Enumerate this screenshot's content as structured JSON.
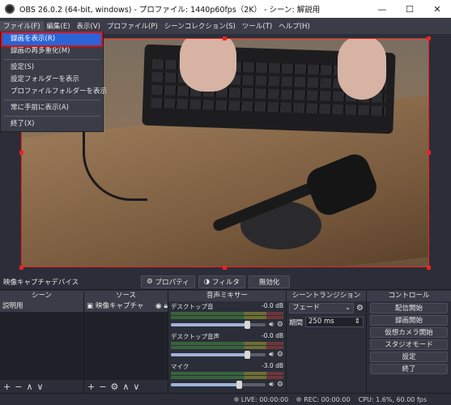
{
  "window": {
    "title": "OBS 26.0.2 (64-bit, windows) - プロファイル: 1440p60fps（2K） - シーン: 解説用",
    "minimize_glyph": "—",
    "maximize_glyph": "☐",
    "close_glyph": "✕"
  },
  "menubar": {
    "items": [
      "ファイル(F)",
      "編集(E)",
      "表示(V)",
      "プロファイル(P)",
      "シーンコレクション(S)",
      "ツール(T)",
      "ヘルプ(H)"
    ]
  },
  "file_menu": {
    "items": [
      "録画を表示(R)",
      "録画の再多重化(M)",
      "設定(S)",
      "設定フォルダーを表示",
      "プロファイルフォルダーを表示",
      "常に手前に表示(A)",
      "終了(X)"
    ]
  },
  "source_toolbar": {
    "source_name": "映像キャプチャデバイス",
    "properties_label": "プロパティ",
    "filters_label": "フィルタ",
    "deactivate_label": "無効化"
  },
  "scenes": {
    "header": "シーン",
    "items": [
      "説明用"
    ]
  },
  "sources": {
    "header": "ソース",
    "items": [
      "映像キャプチャ"
    ]
  },
  "mixer": {
    "header": "音声ミキサー",
    "channels": [
      {
        "name": "デスクトップ音",
        "db": "-0.0 dB",
        "level": 0.8
      },
      {
        "name": "デスクトップ音声",
        "db": "-0.0 dB",
        "level": 0.8
      },
      {
        "name": "マイク",
        "db": "-3.0 dB",
        "level": 0.72
      }
    ]
  },
  "transitions": {
    "header": "シーントランジション",
    "type": "フェード",
    "duration_label": "期間",
    "duration_value": "250 ms"
  },
  "controls": {
    "header": "コントロール",
    "buttons": [
      "配信開始",
      "録画開始",
      "仮想カメラ開始",
      "スタジオモード",
      "設定",
      "終了"
    ]
  },
  "footer_buttons": {
    "add": "+",
    "remove": "−",
    "up": "∧",
    "down": "∨",
    "settings": "⚙"
  },
  "status": {
    "live": "LIVE: 00:00:00",
    "rec": "REC: 00:00:00",
    "cpu": "CPU: 1.6%, 60.00 fps"
  },
  "colors": {
    "accent": "#2a64d6",
    "highlight_border": "#e01010",
    "panel": "#2b2e38"
  }
}
